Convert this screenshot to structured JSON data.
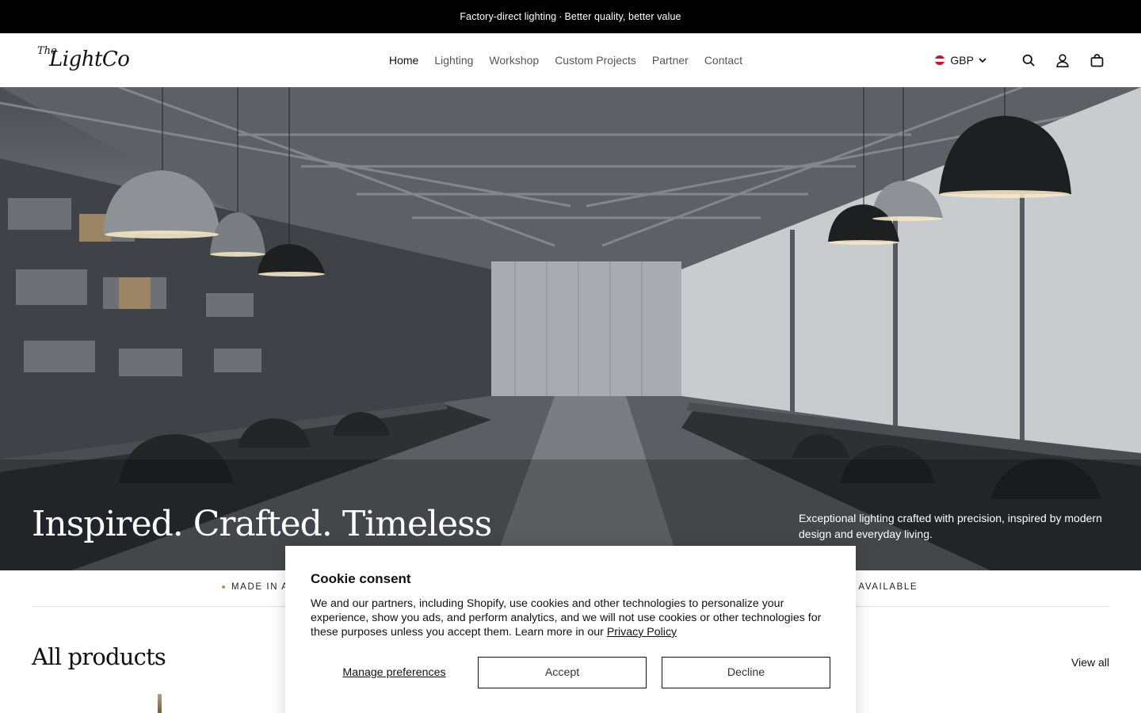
{
  "announcement": {
    "left": "Factory-direct lighting",
    "separator": "·",
    "right": "Better quality, better value"
  },
  "header": {
    "logo": {
      "prefix": "The",
      "name": "LightCo"
    },
    "nav": [
      {
        "label": "Home",
        "active": true
      },
      {
        "label": "Lighting",
        "active": false
      },
      {
        "label": "Workshop",
        "active": false
      },
      {
        "label": "Custom Projects",
        "active": false
      },
      {
        "label": "Partner",
        "active": false
      },
      {
        "label": "Contact",
        "active": false
      }
    ],
    "currency": {
      "code": "GBP",
      "flag": "austria-flag-icon"
    },
    "icons": [
      "search-icon",
      "account-icon",
      "cart-icon"
    ]
  },
  "hero": {
    "title": "Inspired. Crafted. Timeless",
    "subtitle": "Exceptional lighting crafted with precision, inspired by modern design and everyday living.",
    "image": "factory-workshop-with-pendant-lamps"
  },
  "strip": {
    "left_text": "MADE IN A",
    "right_text": "S AVAILABLE"
  },
  "products": {
    "title": "All products",
    "view_all": "View all"
  },
  "cookie": {
    "title": "Cookie consent",
    "body": "We and our partners, including Shopify, use cookies and other technologies to personalize your experience, show you ads, and perform analytics, and we will not use cookies or other technologies for these purposes unless you accept them. Learn more in our ",
    "link": "Privacy Policy",
    "manage": "Manage preferences",
    "accept": "Accept",
    "decline": "Decline"
  },
  "colors": {
    "announcement_bg": "#000000",
    "accent_dot": "#c98a4a",
    "text": "#111111"
  }
}
